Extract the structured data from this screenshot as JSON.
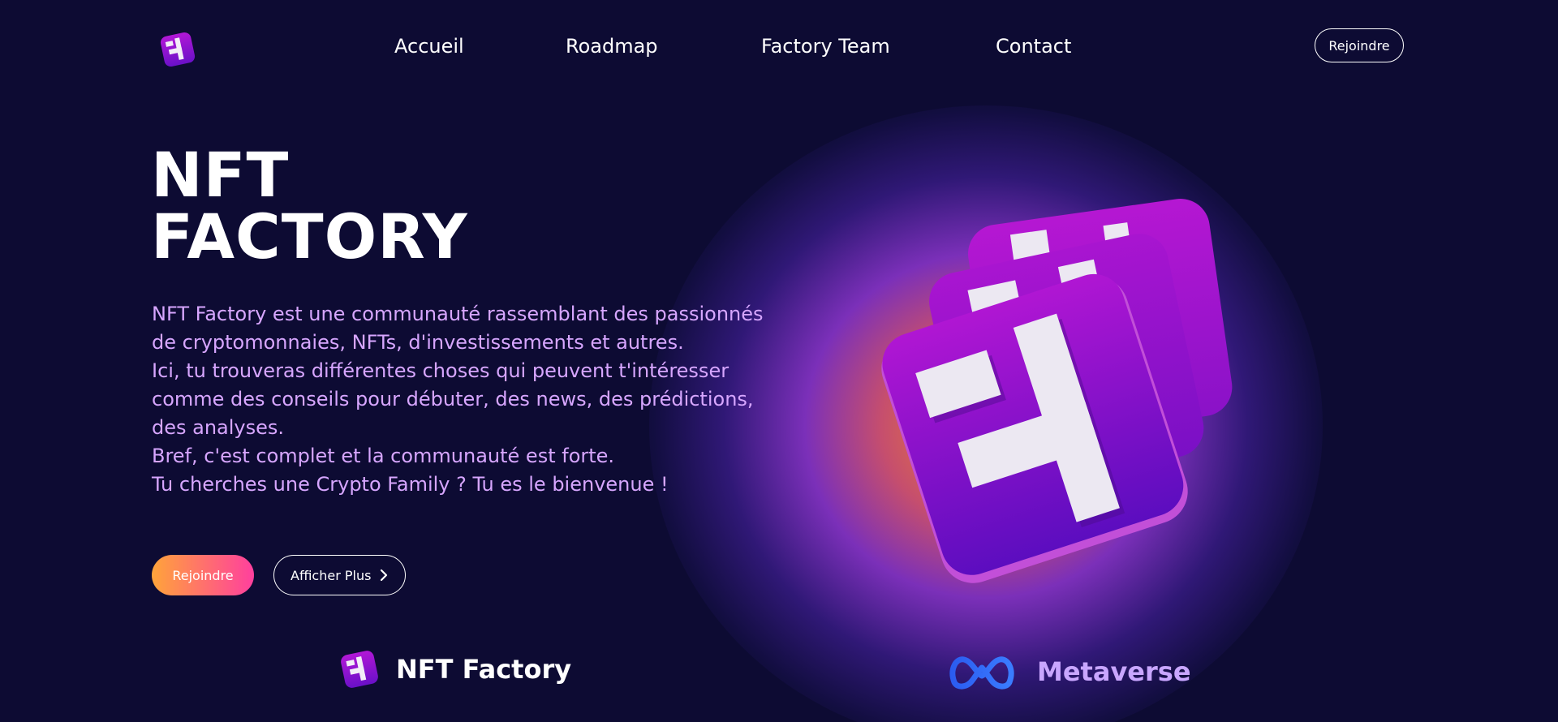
{
  "nav": {
    "links": [
      "Accueil",
      "Roadmap",
      "Factory Team",
      "Contact"
    ],
    "join_label": "Rejoindre",
    "logo_icon": "nft-factory-logo-icon"
  },
  "hero": {
    "title_line1": "NFT",
    "title_line2": "FACTORY",
    "description": [
      "NFT Factory est une communauté rassemblant des passionnés",
      "de cryptomonnaies, NFTs, d'investissements et autres.",
      "Ici, tu trouveras différentes choses qui peuvent t'intéresser",
      "comme des conseils pour débuter, des news, des prédictions,",
      "des analyses.",
      "Bref, c'est complet et la communauté est forte.",
      "Tu cherches une Crypto Family ? Tu es le bienvenue !"
    ],
    "primary_button": "Rejoindre",
    "secondary_button": "Afficher Plus",
    "secondary_icon": "chevron-right-icon",
    "illustration_icon": "stacked-nft-cards-icon"
  },
  "brands": {
    "nft_factory": {
      "name": "NFT Factory",
      "icon": "nft-factory-logo-icon"
    },
    "metaverse": {
      "name": "Metaverse",
      "icon": "meta-infinity-icon"
    }
  },
  "colors": {
    "background": "#0d0b33",
    "accent_purple": "#9b16c9",
    "description_text": "#d7a6ff",
    "gradient_start": "#ffa43a",
    "gradient_end": "#ff3f9e",
    "meta_blue": "#2f6cff",
    "metaverse_text": "#c9a6ff"
  }
}
